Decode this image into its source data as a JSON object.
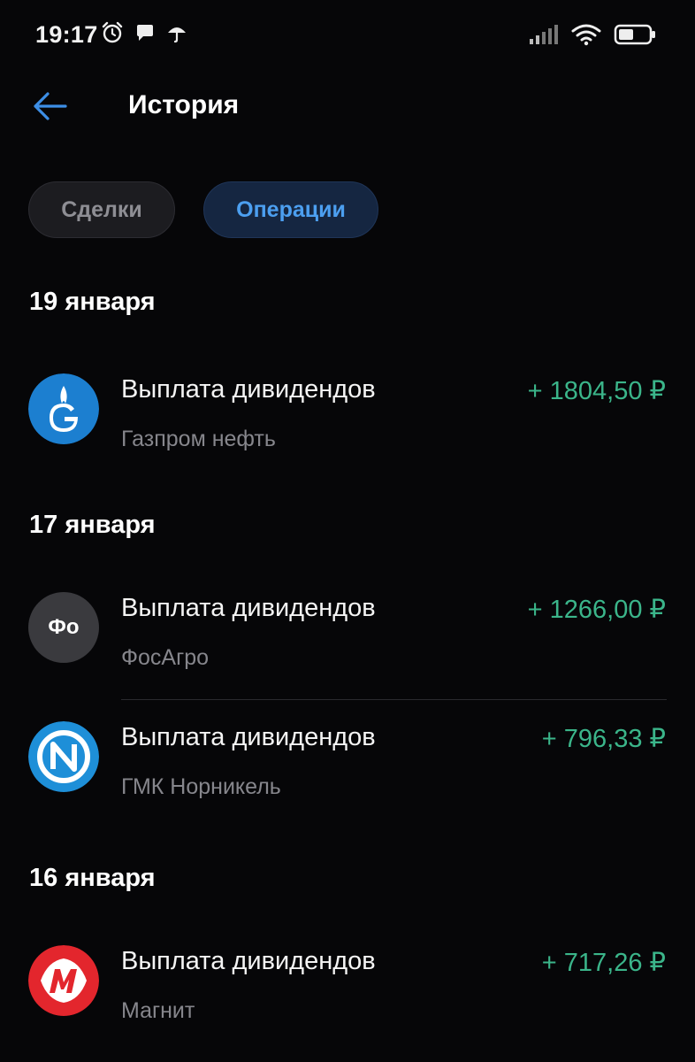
{
  "status_bar": {
    "time": "19:17"
  },
  "header": {
    "title": "История"
  },
  "tabs": [
    {
      "label": "Сделки",
      "active": false
    },
    {
      "label": "Операции",
      "active": true
    }
  ],
  "groups": [
    {
      "date": "19 января",
      "items": [
        {
          "title": "Выплата дивидендов",
          "subtitle": "Газпром нефть",
          "amount": "+ 1804,50 ₽",
          "icon": "gazprom-neft-logo-icon"
        }
      ]
    },
    {
      "date": "17 января",
      "items": [
        {
          "title": "Выплата дивидендов",
          "subtitle": "ФосАгро",
          "amount": "+ 1266,00 ₽",
          "icon": "fosagro-logo-icon",
          "logo_text": "Фо"
        },
        {
          "title": "Выплата дивидендов",
          "subtitle": "ГМК Норникель",
          "amount": "+ 796,33 ₽",
          "icon": "nornickel-logo-icon"
        }
      ]
    },
    {
      "date": "16 января",
      "items": [
        {
          "title": "Выплата дивидендов",
          "subtitle": "Магнит",
          "amount": "+ 717,26 ₽",
          "icon": "magnit-logo-icon"
        }
      ]
    }
  ],
  "colors": {
    "background": "#060608",
    "accent": "#4c9ff0",
    "positive_amount": "#3bb58a",
    "tab_active_bg": "#152641"
  }
}
